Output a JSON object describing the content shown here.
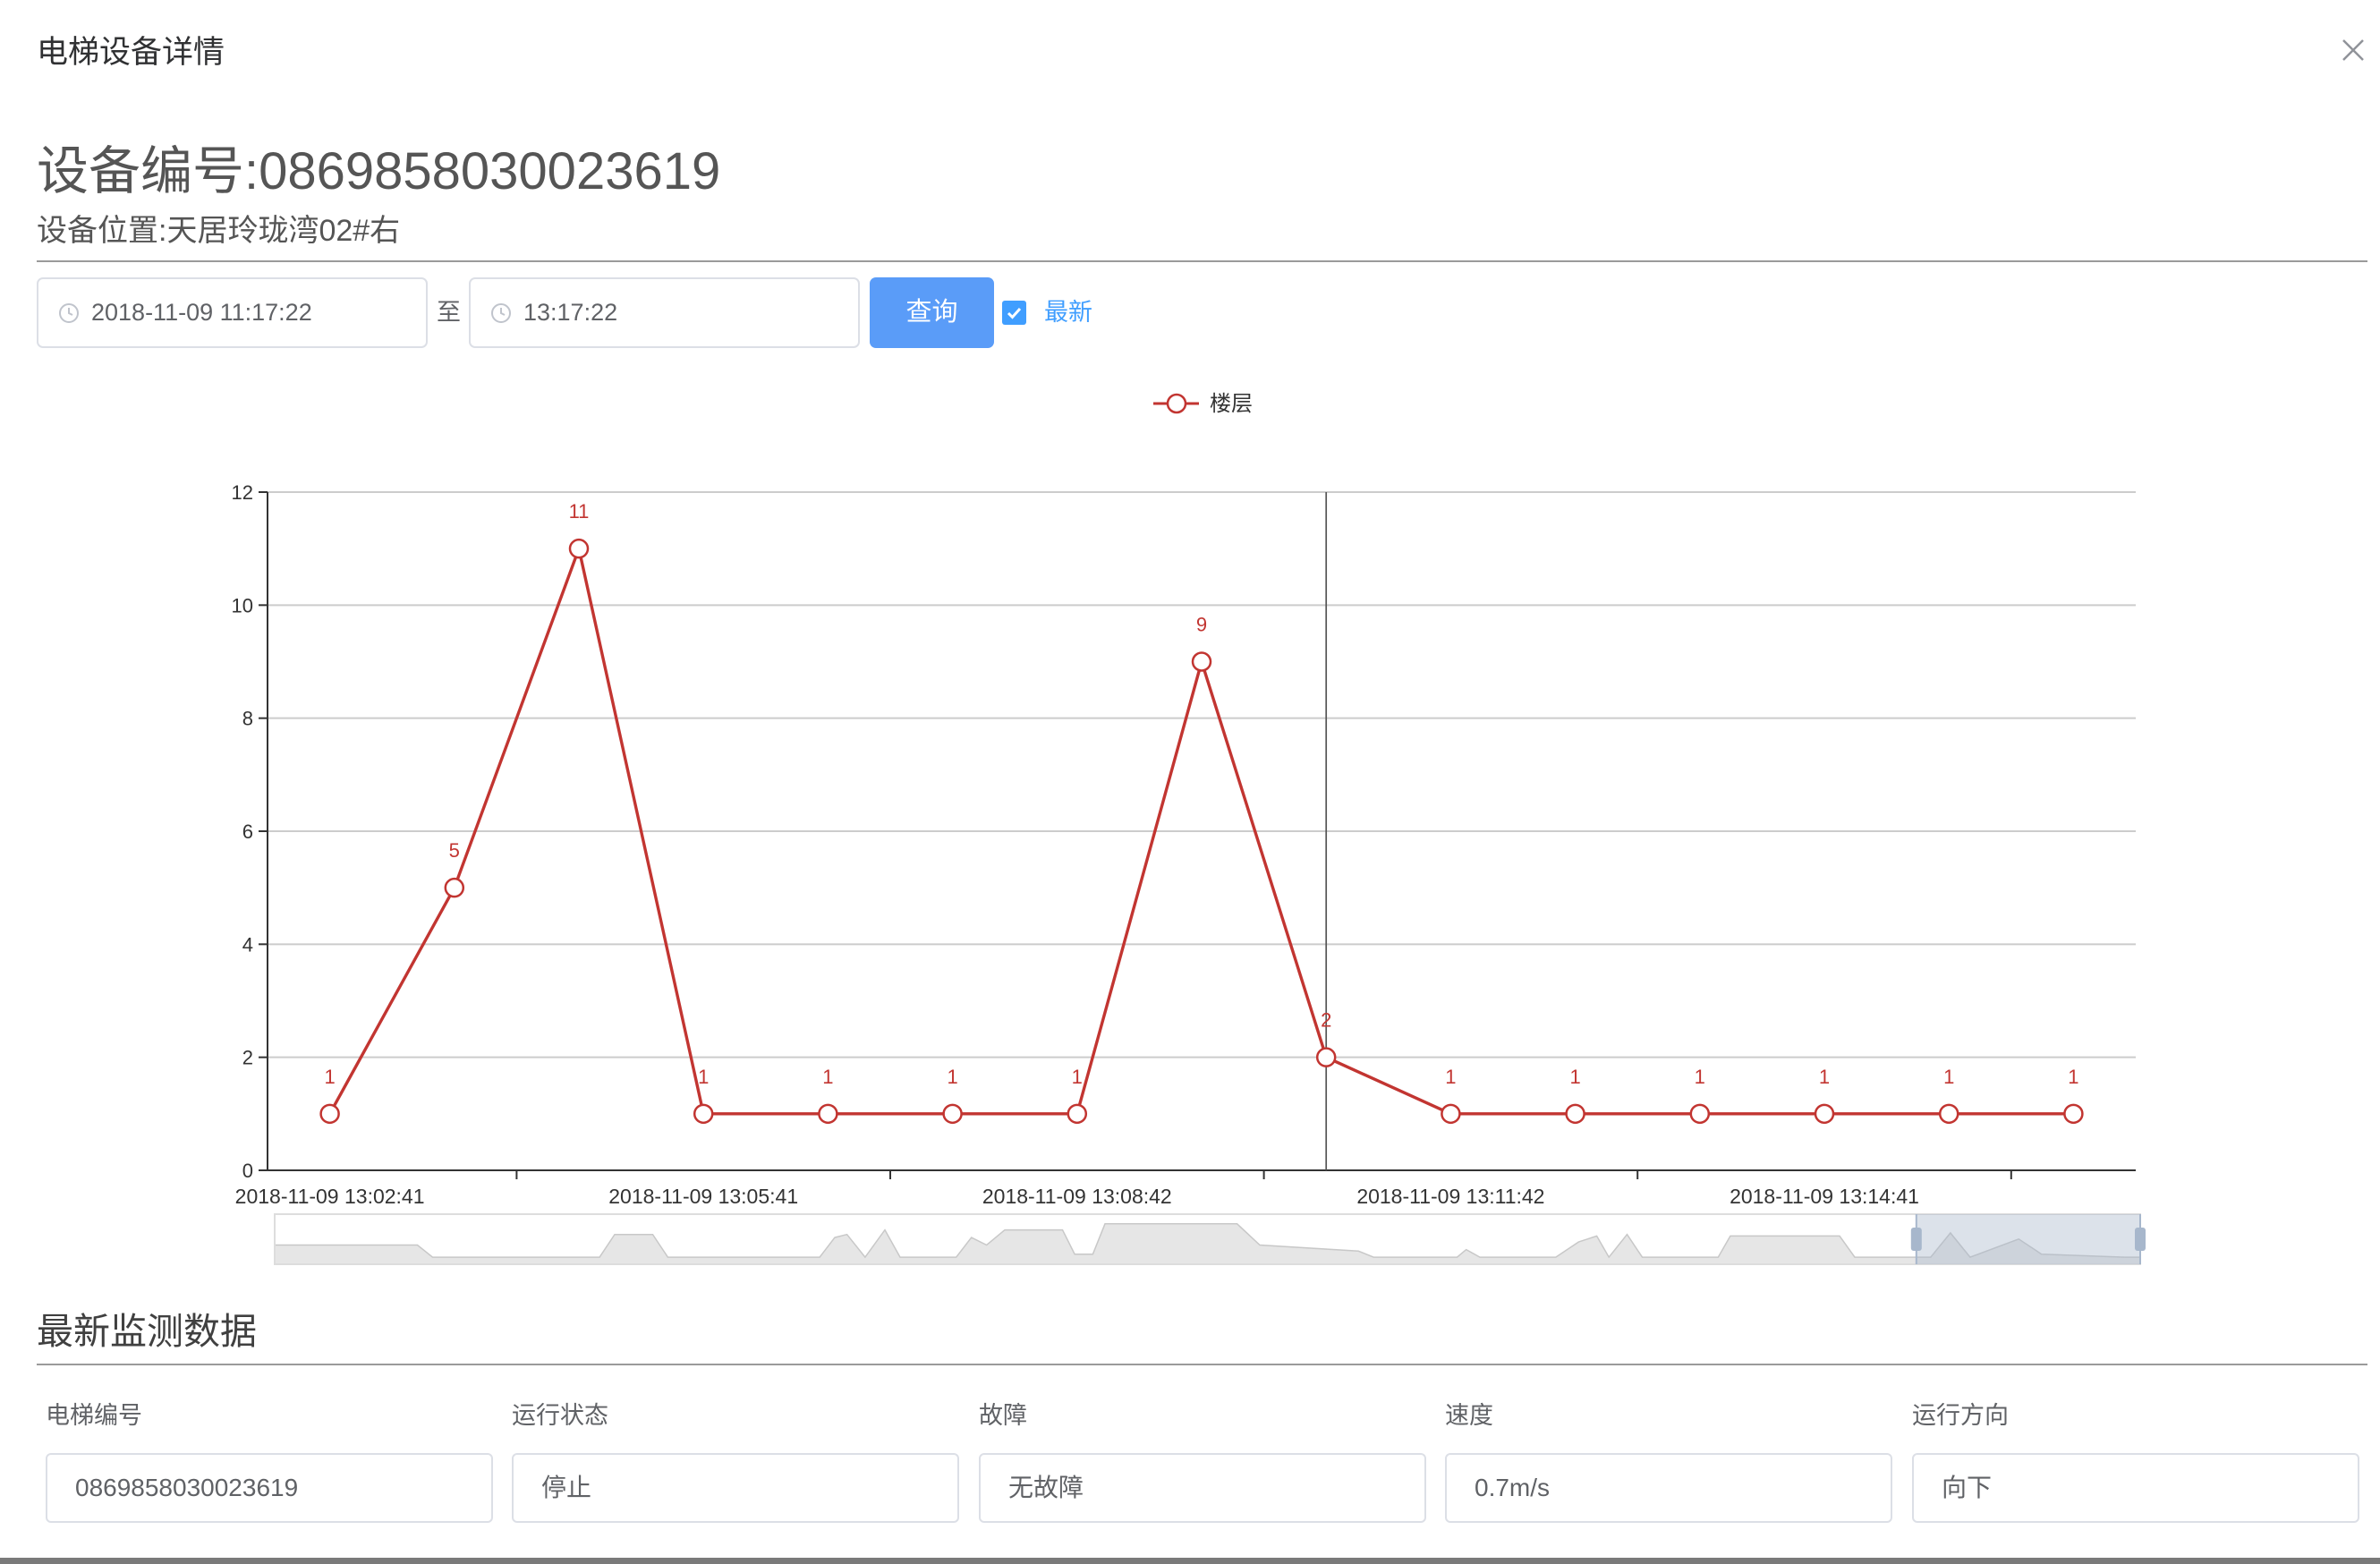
{
  "dialog": {
    "title": "电梯设备详情"
  },
  "device": {
    "number_line": "设备编号:0869858030023619",
    "location_line": "设备位置:天居玲珑湾02#右"
  },
  "query": {
    "start_time": "2018-11-09 11:17:22",
    "separator": "至",
    "end_time": "13:17:22",
    "submit_label": "查询",
    "latest_checked": true,
    "latest_label": "最新"
  },
  "icons": {
    "close": "close-icon",
    "time": "clock-icon",
    "check": "check-icon"
  },
  "colors": {
    "primary": "#409eff",
    "query_button": "#5a9cf8",
    "series": "#c23531"
  },
  "chart_data": {
    "type": "line",
    "title": "",
    "xlabel": "",
    "ylabel": "",
    "legend_placement": "top-center",
    "categories": [
      "2018-11-09 13:02:41",
      "",
      "",
      "2018-11-09 13:05:41",
      "",
      "",
      "2018-11-09 13:08:42",
      "",
      "",
      "2018-11-09 13:11:42",
      "",
      "",
      "2018-11-09 13:14:41",
      "",
      ""
    ],
    "series": [
      {
        "name": "楼层",
        "values": [
          1,
          5,
          11,
          1,
          1,
          1,
          1,
          9,
          2,
          1,
          1,
          1,
          1,
          1,
          1
        ],
        "color": "#c23531",
        "show_labels": true
      }
    ],
    "ylim": [
      0,
      12
    ],
    "yticks": [
      0,
      2,
      4,
      6,
      8,
      10,
      12
    ],
    "grid": true,
    "axis_pointer_index": 8,
    "data_zoom": {
      "start_percent": 88,
      "end_percent": 100
    }
  },
  "latest": {
    "title": "最新监测数据",
    "fields": [
      {
        "label": "电梯编号",
        "value": "0869858030023619"
      },
      {
        "label": "运行状态",
        "value": "停止"
      },
      {
        "label": "故障",
        "value": "无故障"
      },
      {
        "label": "速度",
        "value": "0.7m/s"
      },
      {
        "label": "运行方向",
        "value": "向下"
      }
    ]
  }
}
